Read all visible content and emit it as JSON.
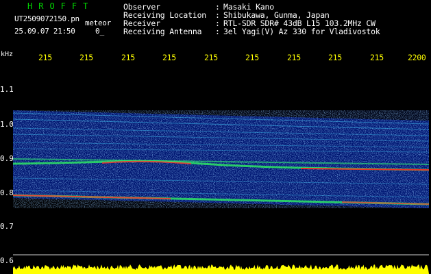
{
  "header": {
    "title": "HROFFT",
    "filename": "UT2509072150.pn",
    "meteor_label": "meteor",
    "datetime": "25.09.07 21:50",
    "zero": "0_",
    "info": [
      {
        "label": "Observer",
        "value": "Masaki Kano"
      },
      {
        "label": "Receiving Location",
        "value": "Shibukawa, Gunma, Japan"
      },
      {
        "label": "Receiver",
        "value": "RTL-SDR SDR# 43dB L15 103.2MHz CW"
      },
      {
        "label": "Receiving Antenna",
        "value": "3el Yagi(V) Az 330 for Vladivostok"
      }
    ],
    "separator": ":"
  },
  "axis": {
    "y_unit": "kHz",
    "y_labels": [
      "1.1",
      "1.0",
      "0.9",
      "0.8",
      "0.7",
      "0.6"
    ],
    "x_labels": [
      "215",
      "215",
      "215",
      "215",
      "215",
      "215",
      "215",
      "215",
      "215",
      "2200"
    ]
  },
  "colors": {
    "title": "#00d800",
    "header_text": "#ffffff",
    "tick_text": "#ffff00",
    "axis_text": "#ffffff",
    "background": "#000000",
    "spectrogram_base": "#001670",
    "amplitude": "#ffff00"
  }
}
